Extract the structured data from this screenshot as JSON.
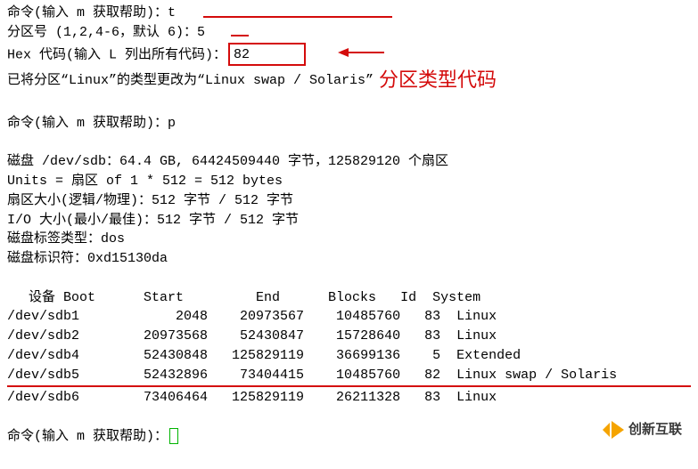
{
  "l1_prefix": "命令(输入 m 获取帮助)：",
  "l1_input": "t",
  "l2_prefix": "分区号 (1,2,4-6，默认 6)：",
  "l2_input": "5",
  "l3_prefix": "Hex 代码(输入 L 列出所有代码)：",
  "l3_input": "82",
  "l4": "已将分区“Linux”的类型更改为“Linux swap / Solaris”",
  "annotation": "分区类型代码",
  "l5_prefix": "命令(输入 m 获取帮助)：",
  "l5_input": "p",
  "disk_line": "磁盘 /dev/sdb：64.4 GB, 64424509440 字节，125829120 个扇区",
  "units_line": "Units = 扇区 of 1 * 512 = 512 bytes",
  "sector_line": "扇区大小(逻辑/物理)：512 字节 / 512 字节",
  "io_line": "I/O 大小(最小/最佳)：512 字节 / 512 字节",
  "label_line": "磁盘标签类型：dos",
  "ident_line": "磁盘标识符：0xd15130da",
  "table": {
    "header": "设备 Boot      Start         End      Blocks   Id  System",
    "rows": [
      "/dev/sdb1            2048    20973567    10485760   83  Linux",
      "/dev/sdb2        20973568    52430847    15728640   83  Linux",
      "/dev/sdb4        52430848   125829119    36699136    5  Extended",
      "/dev/sdb5        52432896    73404415    10485760   82  Linux swap / Solaris",
      "/dev/sdb6        73406464   125829119    26211328   83  Linux"
    ]
  },
  "l_last_prefix": "命令(输入 m 获取帮助)：",
  "logo_text": "创新互联"
}
